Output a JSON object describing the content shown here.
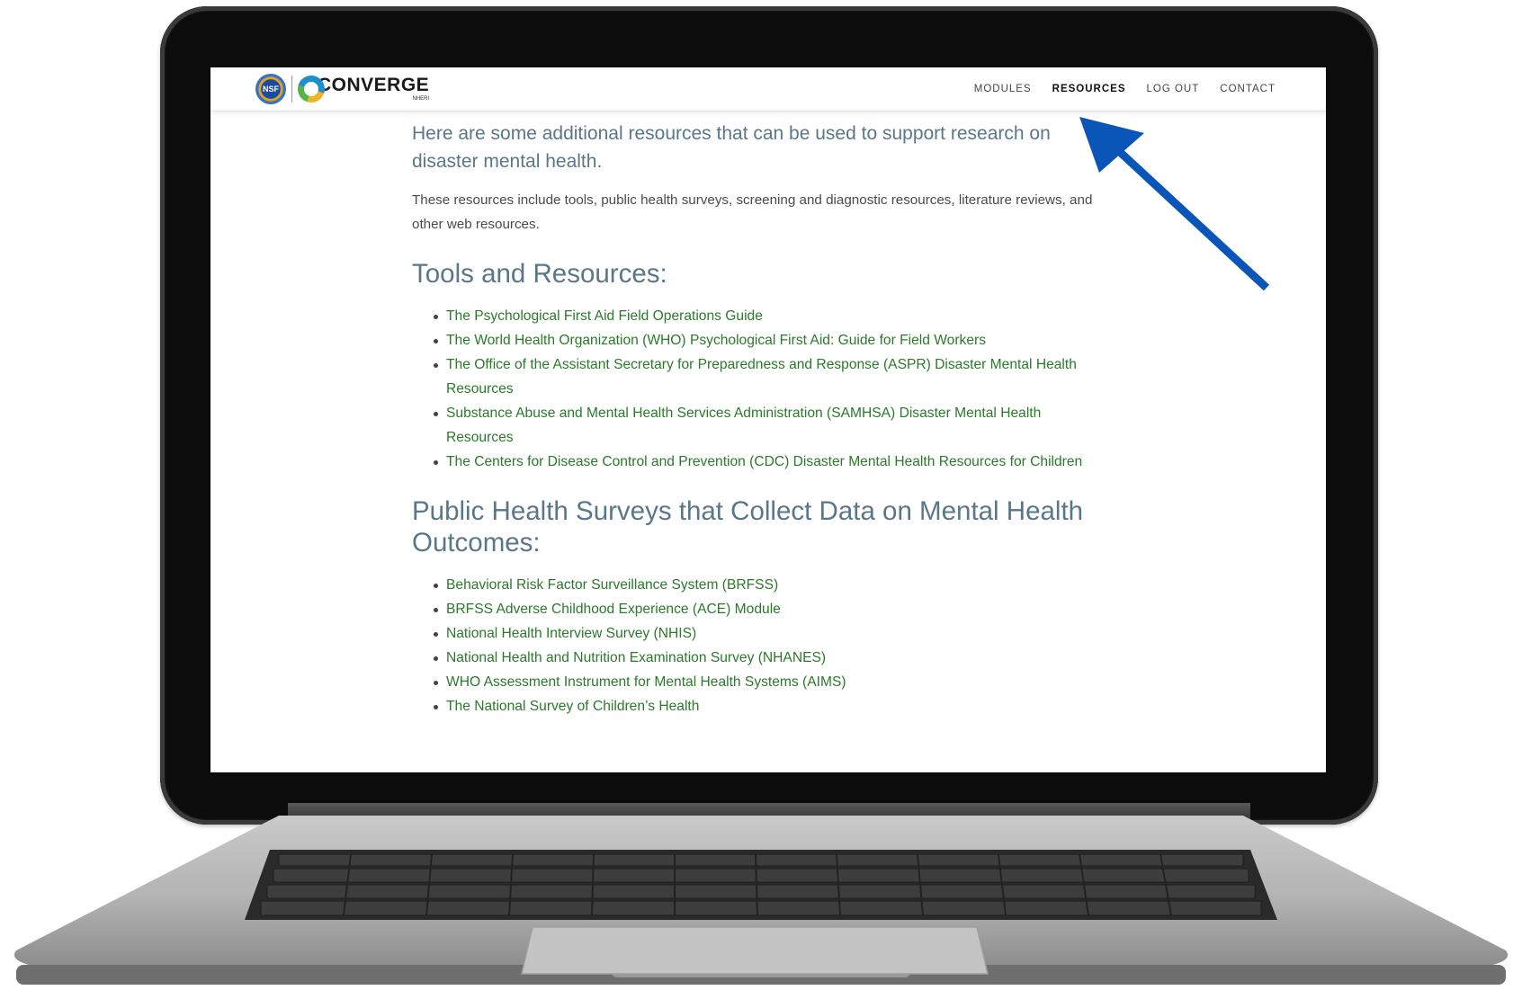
{
  "site": {
    "nsf_label": "NSF",
    "brand": "CONVERGE",
    "brand_sub": "NHERI"
  },
  "nav": {
    "items": [
      {
        "label": "MODULES"
      },
      {
        "label": "RESOURCES"
      },
      {
        "label": "LOG OUT"
      },
      {
        "label": "CONTACT"
      }
    ],
    "active": "RESOURCES"
  },
  "content": {
    "intro_lead": "Here are some additional resources that can be used to support research on disaster mental health.",
    "intro_body": "These resources include tools, public health surveys, screening and diagnostic resources, literature reviews, and other web resources.",
    "sections": [
      {
        "heading": "Tools and Resources:",
        "links": [
          "The Psychological First Aid Field Operations Guide",
          "The World Health Organization (WHO) Psychological First Aid: Guide for Field Workers",
          "The Office of the Assistant Secretary for Preparedness and Response (ASPR) Disaster Mental Health Resources",
          "Substance Abuse and Mental Health Services Administration (SAMHSA) Disaster Mental Health Resources",
          "The Centers for Disease Control and Prevention (CDC) Disaster Mental Health Resources for Children"
        ]
      },
      {
        "heading": "Public Health Surveys that Collect Data on Mental Health Outcomes:",
        "links": [
          "Behavioral Risk Factor Surveillance System (BRFSS)",
          "BRFSS Adverse Childhood Experience (ACE) Module",
          "National Health Interview Survey (NHIS)",
          "National Health and Nutrition Examination Survey (NHANES)",
          "WHO Assessment Instrument for Mental Health Systems (AIMS)",
          "The National Survey of Children’s Health"
        ]
      }
    ]
  },
  "colors": {
    "heading": "#5a7789",
    "link": "#2a7a2a",
    "arrow": "#0a56b8"
  }
}
